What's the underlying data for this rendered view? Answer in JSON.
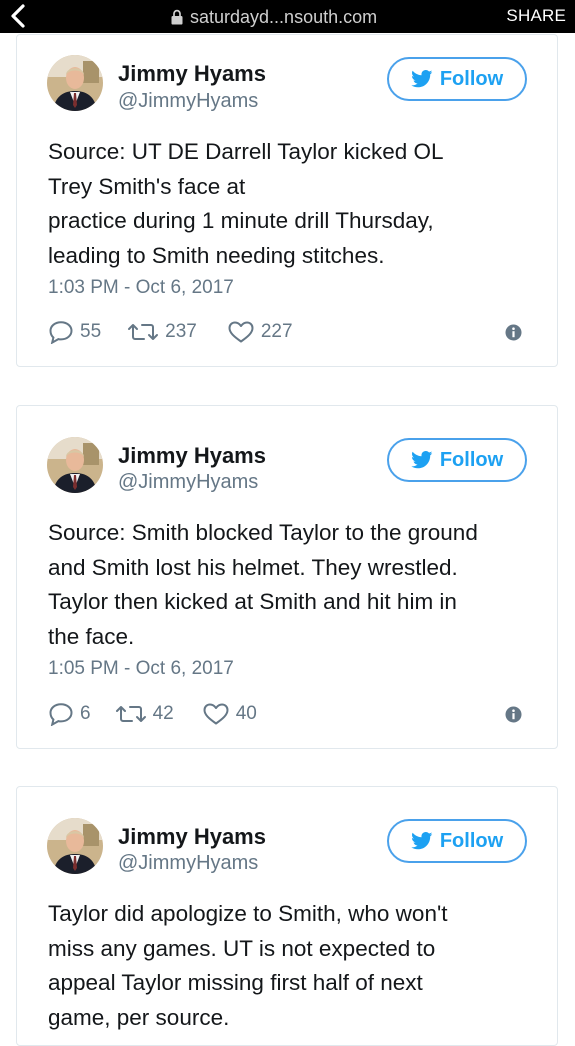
{
  "browser": {
    "url": "saturdayd...nsouth.com",
    "share_label": "SHARE"
  },
  "colors": {
    "twitter_blue": "#1da1f2",
    "follow_border": "#4aa1eb",
    "gray_text": "#657786",
    "dark_text": "#14171a",
    "card_border": "#e1e8ed"
  },
  "tweets": [
    {
      "name": "Jimmy Hyams",
      "handle": "@JimmyHyams",
      "follow_label": "Follow",
      "text_lines": [
        "Source: UT DE Darrell Taylor kicked OL",
        "Trey Smith's face at",
        "practice during 1 minute drill Thursday,",
        "leading to Smith needing stitches."
      ],
      "timestamp": "1:03 PM - Oct 6, 2017",
      "replies": "55",
      "retweets": "237",
      "likes": "227"
    },
    {
      "name": "Jimmy Hyams",
      "handle": "@JimmyHyams",
      "follow_label": "Follow",
      "text_lines": [
        "Source: Smith blocked Taylor to the ground",
        "and Smith lost his helmet. They wrestled.",
        "Taylor then kicked at Smith and hit him in",
        "the face."
      ],
      "timestamp": "1:05 PM - Oct 6, 2017",
      "replies": "6",
      "retweets": "42",
      "likes": "40"
    },
    {
      "name": "Jimmy Hyams",
      "handle": "@JimmyHyams",
      "follow_label": "Follow",
      "text_lines": [
        "Taylor did apologize to Smith, who won't",
        "miss any games. UT is not expected to",
        "appeal Taylor missing first half of next",
        "game, per source."
      ]
    }
  ]
}
